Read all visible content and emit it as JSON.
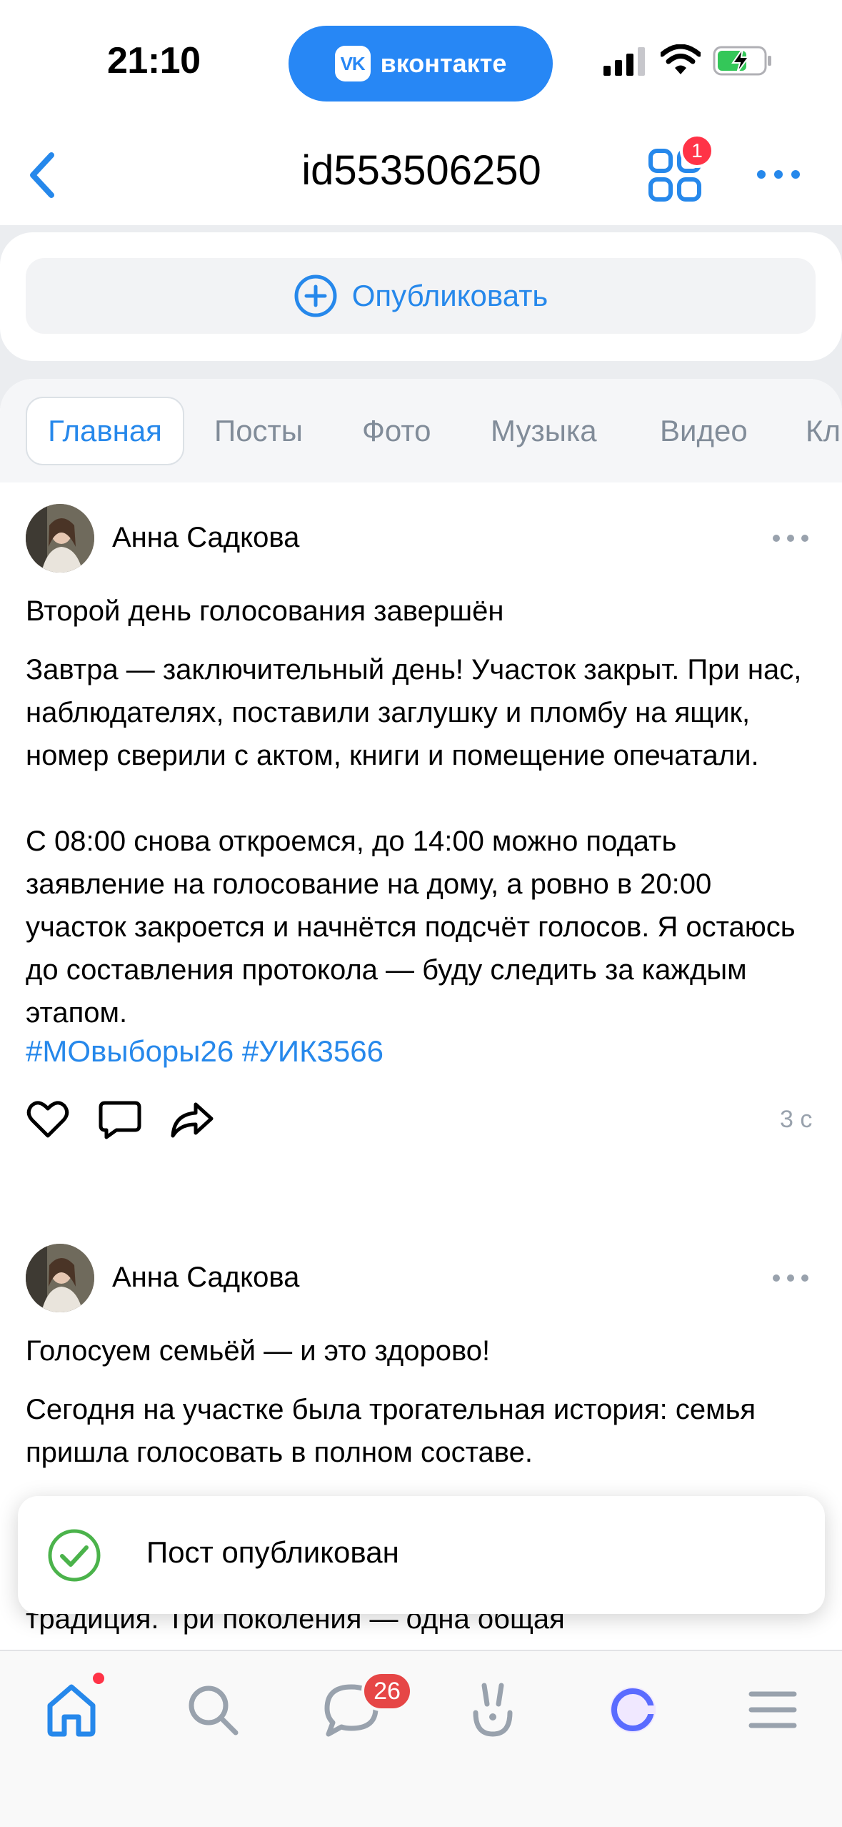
{
  "status_bar": {
    "time": "21:10",
    "app_pill": "вконтакте",
    "app_logo": "VK"
  },
  "header": {
    "title": "id553506250",
    "apps_badge": "1"
  },
  "publish": {
    "label": "Опубликовать"
  },
  "tabs": [
    {
      "label": "Главная"
    },
    {
      "label": "Посты"
    },
    {
      "label": "Фото"
    },
    {
      "label": "Музыка"
    },
    {
      "label": "Видео"
    },
    {
      "label": "Кл"
    }
  ],
  "posts": [
    {
      "author": "Анна Садкова",
      "paragraphs": [
        "Второй день голосования завершён",
        "Завтра — заключительный день! Участок закрыт. При нас, наблюдателях, поставили заглушку и пломбу на ящик, номер сверили с актом, книги и помещение опечатали.",
        "С 08:00 снова откроемся, до 14:00 можно подать заявление на голосование на дому, а ровно в 20:00 участок закроется и начнётся подсчёт голосов. Я остаюсь до составления протокола — буду следить за каждым этапом."
      ],
      "hashtags": "#МОвыборы26 #УИК3566",
      "time": "3 с"
    },
    {
      "author": "Анна Садкова",
      "paragraphs": [
        "Голосуем семьёй — и это здорово!",
        "Сегодня на участке была трогательная история: семья пришла голосовать в полном составе.",
        "традиция. Три поколения — одна общая"
      ]
    }
  ],
  "toast": {
    "text": "Пост опубликован"
  },
  "tabbar": {
    "messages_badge": "26"
  },
  "colors": {
    "accent": "#2688eb",
    "badge": "#ff3347",
    "success": "#4bb34b"
  }
}
